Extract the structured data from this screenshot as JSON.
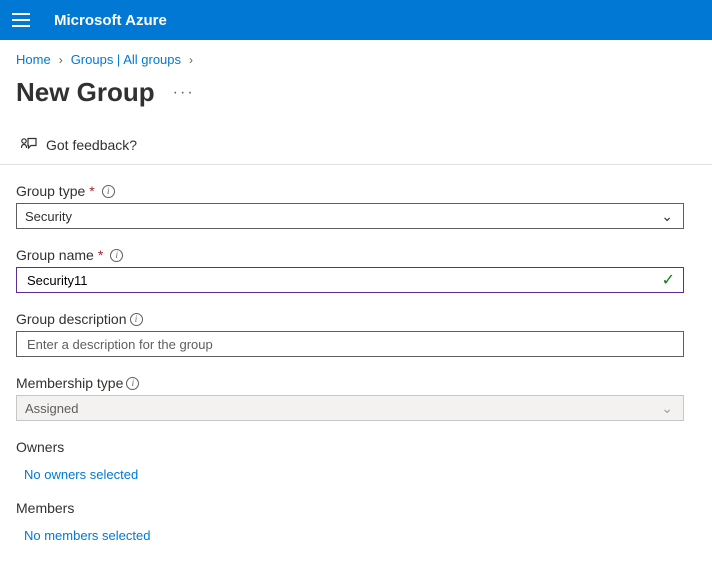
{
  "header": {
    "brand": "Microsoft Azure"
  },
  "breadcrumb": {
    "home": "Home",
    "groups": "Groups | All groups"
  },
  "page": {
    "title": "New Group"
  },
  "feedback": {
    "label": "Got feedback?"
  },
  "form": {
    "group_type": {
      "label": "Group type",
      "value": "Security"
    },
    "group_name": {
      "label": "Group name",
      "value": "Security11"
    },
    "group_description": {
      "label": "Group description",
      "placeholder": "Enter a description for the group",
      "value": ""
    },
    "membership_type": {
      "label": "Membership type",
      "value": "Assigned"
    },
    "owners": {
      "heading": "Owners",
      "empty_link": "No owners selected"
    },
    "members": {
      "heading": "Members",
      "empty_link": "No members selected"
    }
  }
}
